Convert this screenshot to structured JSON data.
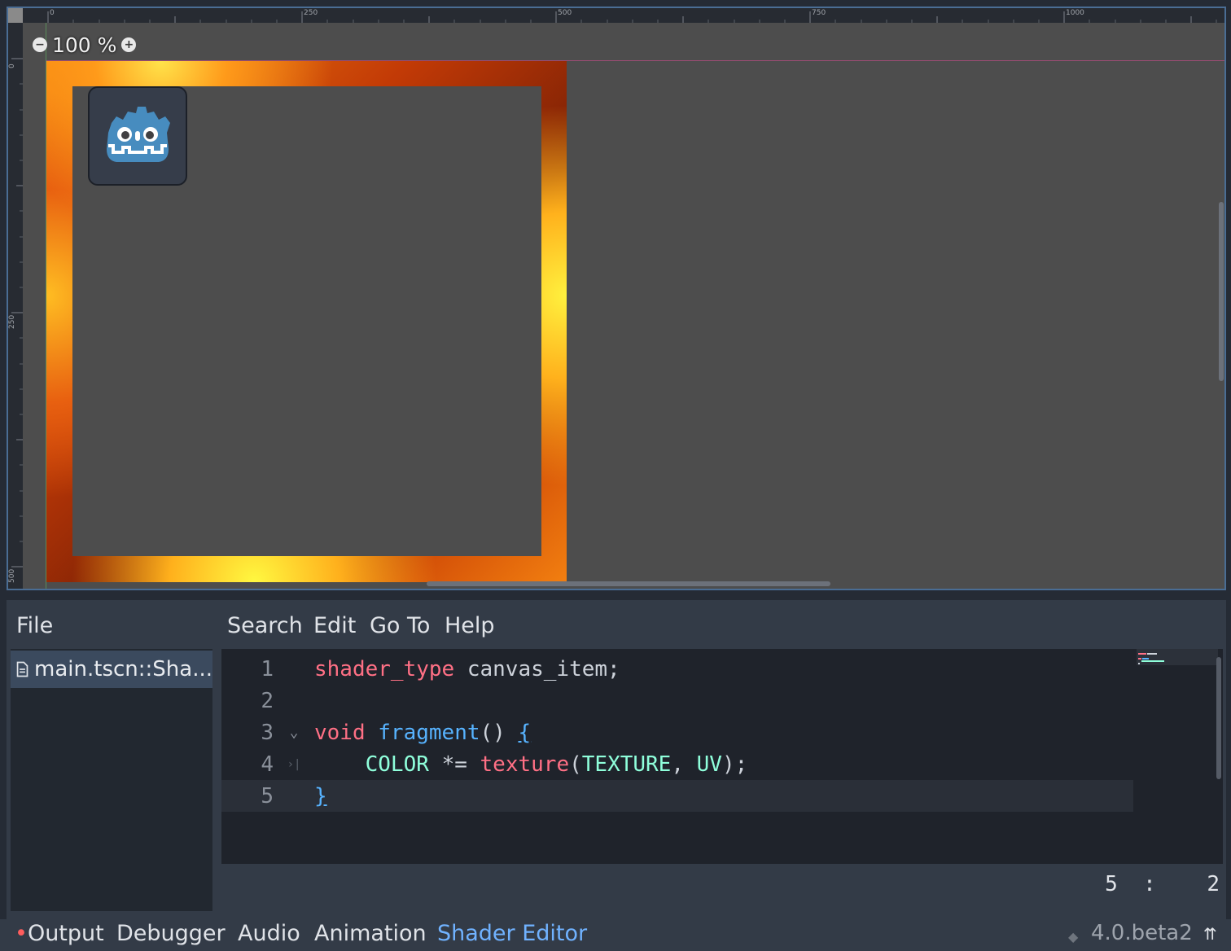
{
  "viewport": {
    "zoom_level": "100 %",
    "ruler_top_labels": [
      "0",
      "250",
      "500",
      "750",
      "1000"
    ],
    "ruler_left_labels": [
      "0",
      "250",
      "500"
    ]
  },
  "editor": {
    "menus": {
      "file": "File",
      "search": "Search",
      "edit": "Edit",
      "goto": "Go To",
      "help": "Help"
    },
    "open_file": "main.tscn::Sha...",
    "code_lines": [
      {
        "num": "1",
        "text": "shader_type canvas_item;"
      },
      {
        "num": "2",
        "text": ""
      },
      {
        "num": "3",
        "text": "void fragment() {"
      },
      {
        "num": "4",
        "text": "COLOR *= texture(TEXTURE, UV);"
      },
      {
        "num": "5",
        "text": "}"
      }
    ],
    "cursor_line": "5",
    "cursor_col": "2"
  },
  "bottom_bar": {
    "tabs": [
      "Output",
      "Debugger",
      "Audio",
      "Animation",
      "Shader Editor"
    ],
    "active_tab": "Shader Editor",
    "version": "4.0.beta2"
  },
  "colors": {
    "accent": "#70b2ff",
    "keyword": "#ff7085",
    "function": "#57b3ff",
    "builtin": "#8fffdb"
  }
}
